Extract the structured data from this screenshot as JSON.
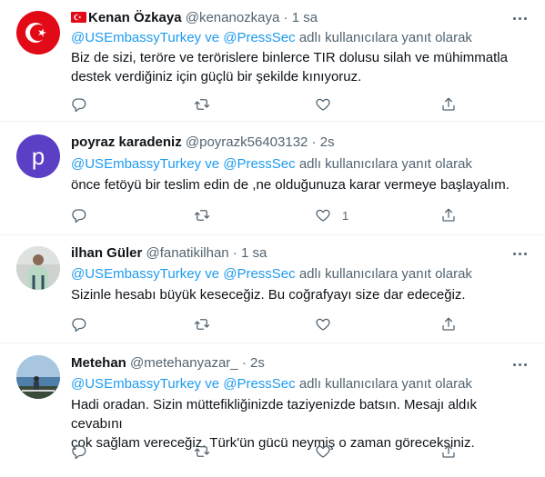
{
  "replying_suffix": "adlı kullanıcılara yanıt olarak",
  "mention_1": "@USEmbassyTurkey",
  "mention_join": "ve",
  "mention_2": "@PressSec",
  "colors": {
    "link": "#1d9bf0",
    "secondary_text": "#536471",
    "divider": "#eff3f4",
    "avatar_poyraz": "#5b3fc5"
  },
  "tweets": [
    {
      "name": "Kenan Özkaya",
      "handle": "@kenanozkaya",
      "time": "1 sa",
      "has_flag": true,
      "lines": [
        "Biz de sizi, teröre ve terörislere binlerce TIR dolusu silah ve mühimmatla",
        "destek verdiğiniz için güçlü bir şekilde kınıyoruz."
      ],
      "like_count": ""
    },
    {
      "name": "poyraz karadeniz",
      "handle": "@poyrazk56403132",
      "time": "2s",
      "avatar_letter": "p",
      "lines": [
        "önce fetöyü bir teslim edin de ,ne olduğunuza karar vermeye başlayalım."
      ],
      "like_count": "1"
    },
    {
      "name": "ilhan Güler",
      "handle": "@fanatikilhan",
      "time": "1 sa",
      "lines": [
        "Sizinle hesabı büyük keseceğiz. Bu coğrafyayı size dar edeceğiz."
      ],
      "like_count": ""
    },
    {
      "name": "Metehan",
      "handle": "@metehanyazar_",
      "time": "2s",
      "lines": [
        "Hadi oradan. Sizin müttefikliğinizde taziyenizde batsın. Mesajı aldık cevabını",
        "çok sağlam vereceğiz. Türk'ün gücü neymiş o zaman göreceksiniz."
      ],
      "like_count": ""
    }
  ]
}
